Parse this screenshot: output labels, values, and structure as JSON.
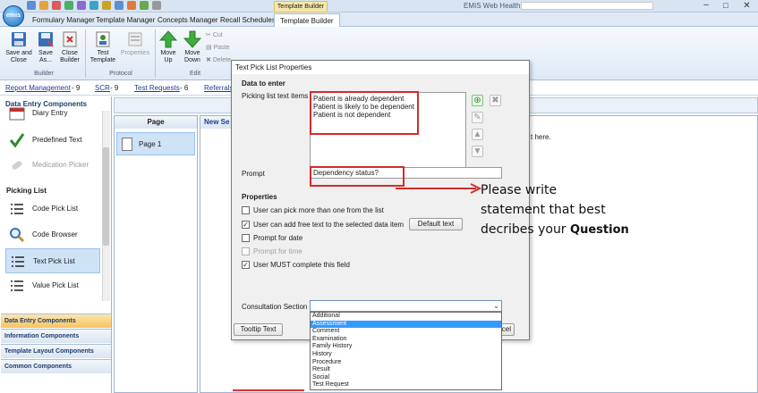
{
  "window": {
    "app_title": "EMIS Web Health Care System -",
    "context_tab": "Template Builder"
  },
  "tabs": [
    "Formulary Manager",
    "Template Manager",
    "Concepts Manager",
    "Recall Schedules",
    "Template Builder"
  ],
  "logo_text": "emis",
  "ribbon": {
    "groups": {
      "builder": "Builder",
      "protocol": "Protocol",
      "edit": "Edit"
    },
    "buttons": {
      "save_close": "Save and Close",
      "save_as": "Save As...",
      "close_builder": "Close Builder",
      "test_template": "Test Template",
      "properties": "Properties",
      "move_up": "Move Up",
      "move_down": "Move Down",
      "cut": "Cut",
      "paste": "Paste",
      "delete": "Delete"
    }
  },
  "links": [
    {
      "label": "Report Management",
      "count": "- 9"
    },
    {
      "label": "SCR",
      "count": "- 9"
    },
    {
      "label": "Test Requests",
      "count": "- 6"
    },
    {
      "label": "Referrals",
      "count": ""
    }
  ],
  "left_panel": {
    "header": "Data Entry Components",
    "items": [
      "Diary Entry",
      "Predefined Text",
      "Medication Picker"
    ],
    "section": "Picking List",
    "picking_items": [
      "Code Pick List",
      "Code Browser",
      "Text Pick List",
      "Value Pick List"
    ],
    "accordion": [
      "Data Entry Components",
      "Information Components",
      "Template Layout Components",
      "Common Components"
    ]
  },
  "page_panel": {
    "header": "Page",
    "item": "Page 1"
  },
  "canvas": {
    "header": "New Se",
    "text": "t here."
  },
  "dialog": {
    "title": "Text Pick List Properties",
    "data_to_enter": "Data to enter",
    "picking_label": "Picking list text items",
    "picking_items": [
      "Patient is already dependent",
      "Patient is likely to be dependent",
      "Patient is not dependent"
    ],
    "prompt_label": "Prompt",
    "prompt_value": "Dependency status?",
    "properties_label": "Properties",
    "checkboxes": [
      {
        "label": "User can pick more than one from the list",
        "checked": false,
        "disabled": false
      },
      {
        "label": "User can add free text to the selected data item",
        "checked": true,
        "disabled": false
      },
      {
        "label": "Prompt for date",
        "checked": false,
        "disabled": false
      },
      {
        "label": "Prompt for time",
        "checked": false,
        "disabled": true
      },
      {
        "label": "User MUST complete this field",
        "checked": true,
        "disabled": false
      }
    ],
    "default_text_button": "Default text",
    "consultation_label": "Consultation Section",
    "consultation_options": [
      "Additional",
      "Assessment",
      "Comment",
      "Examination",
      "Family History",
      "History",
      "Procedure",
      "Result",
      "Social",
      "Test Request"
    ],
    "consultation_highlighted": "Assessment",
    "tooltip_button": "Tooltip Text",
    "cancel_button": "Cancel",
    "cancel_visible": "ncel"
  },
  "annotation": {
    "line1": "Please write",
    "line2": "statement that best",
    "line3": "decribes your",
    "line3_bold": "Question"
  },
  "colors": {
    "highlight_red": "#d42b2b",
    "selection_blue": "#3399ff",
    "accordion_active": "#f7c35d"
  }
}
